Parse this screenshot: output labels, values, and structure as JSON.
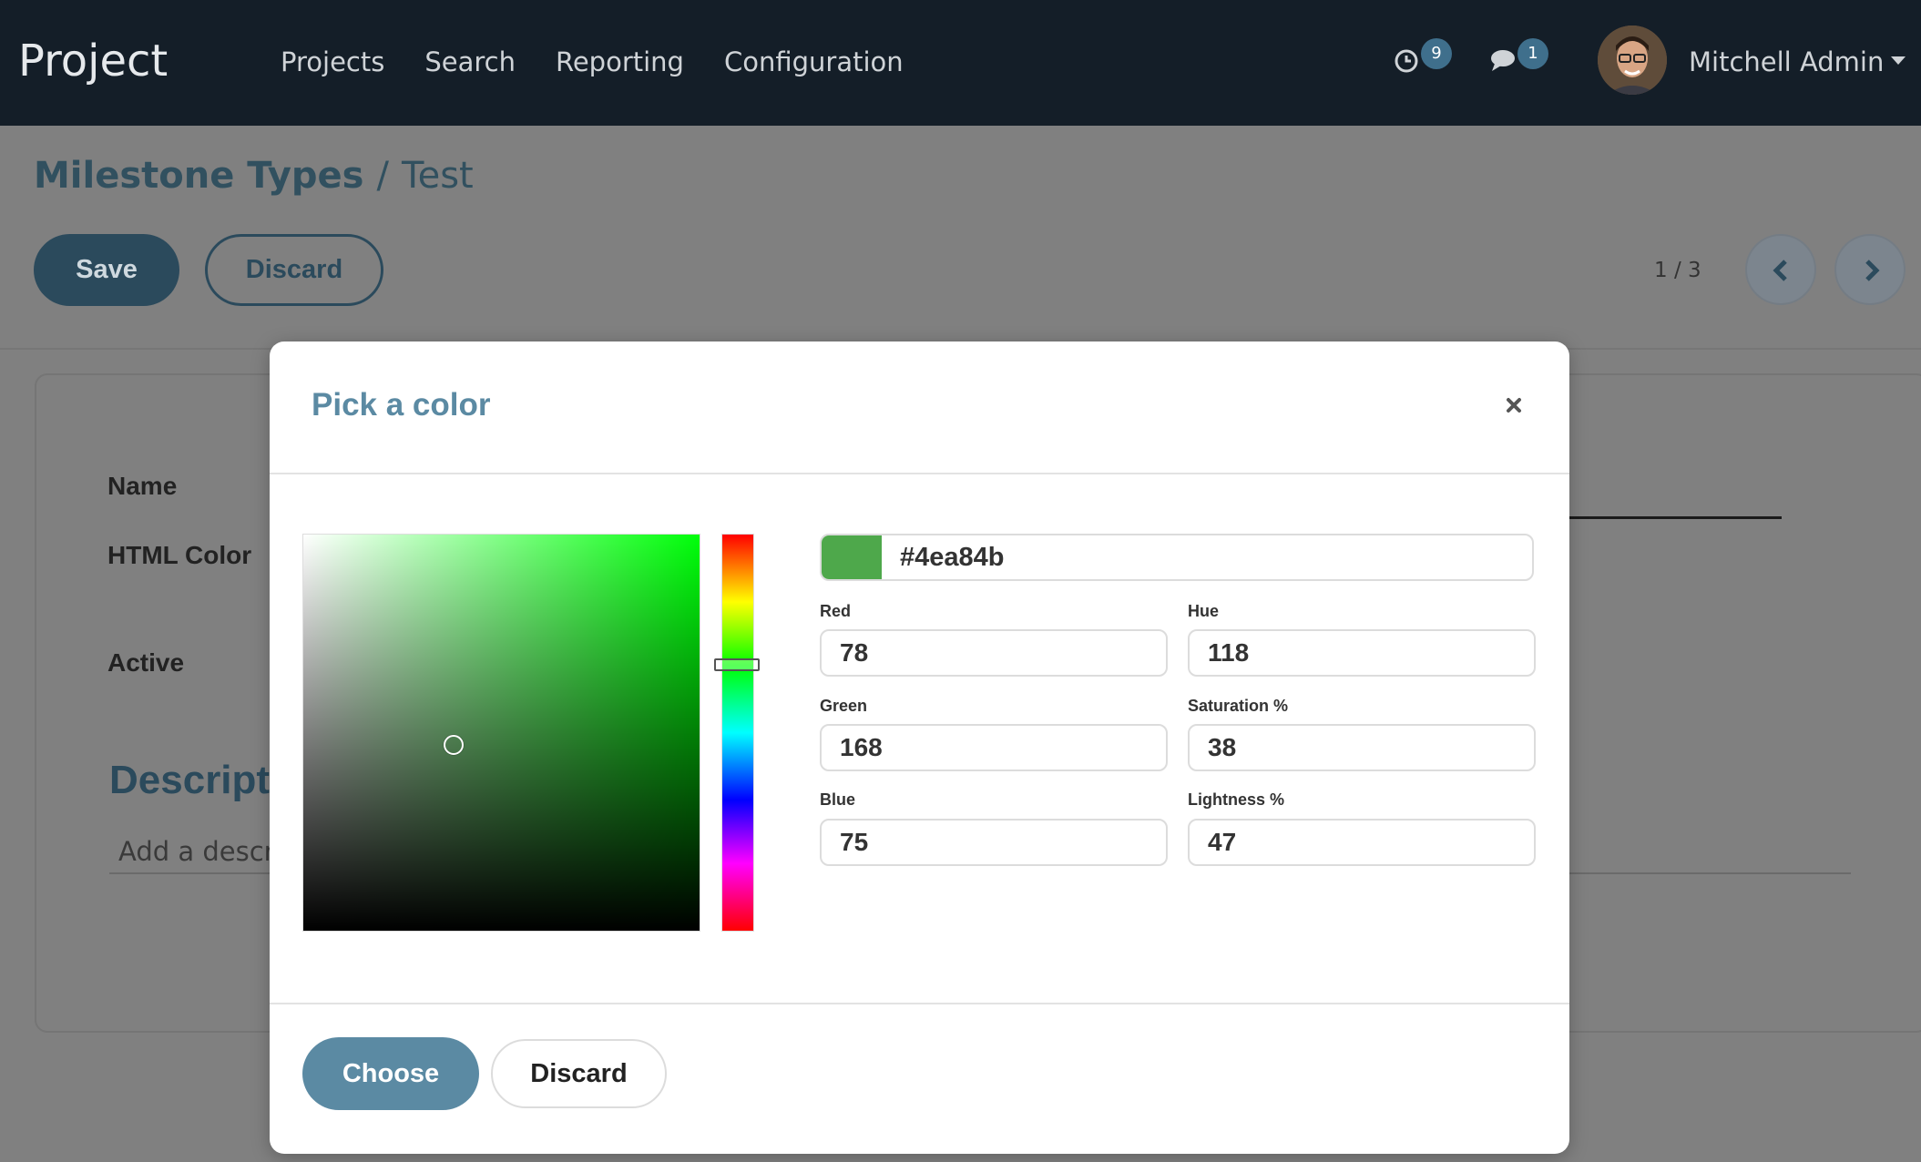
{
  "navbar": {
    "brand": "Project",
    "menu": [
      "Projects",
      "Search",
      "Reporting",
      "Configuration"
    ],
    "activity_badge": "9",
    "messages_badge": "1",
    "user_name": "Mitchell Admin"
  },
  "control_panel": {
    "breadcrumb_parent": "Milestone Types",
    "breadcrumb_separator": "/",
    "breadcrumb_current": "Test",
    "save_label": "Save",
    "discard_label": "Discard",
    "pager_value": "1 / 3"
  },
  "form": {
    "name_label": "Name",
    "html_color_label": "HTML Color",
    "active_label": "Active",
    "description_heading": "Descript",
    "description_placeholder": "Add a descri"
  },
  "modal": {
    "title": "Pick a color",
    "hex_value": "#4ea84b",
    "swatch_color": "#4ea84b",
    "hue_base_color": "#00ff0a",
    "saturation_value": 0.38,
    "hsv_value": 0.47,
    "hue_fraction": 0.328,
    "fields": {
      "red": {
        "label": "Red",
        "value": "78"
      },
      "green": {
        "label": "Green",
        "value": "168"
      },
      "blue": {
        "label": "Blue",
        "value": "75"
      },
      "hue": {
        "label": "Hue",
        "value": "118"
      },
      "saturation": {
        "label": "Saturation %",
        "value": "38"
      },
      "lightness": {
        "label": "Lightness %",
        "value": "47"
      }
    },
    "choose_label": "Choose",
    "discard_label": "Discard"
  },
  "colors": {
    "navbar_bg": "#141e28",
    "accent": "#5b8aa3",
    "primary_dark": "#2b4a5c"
  }
}
